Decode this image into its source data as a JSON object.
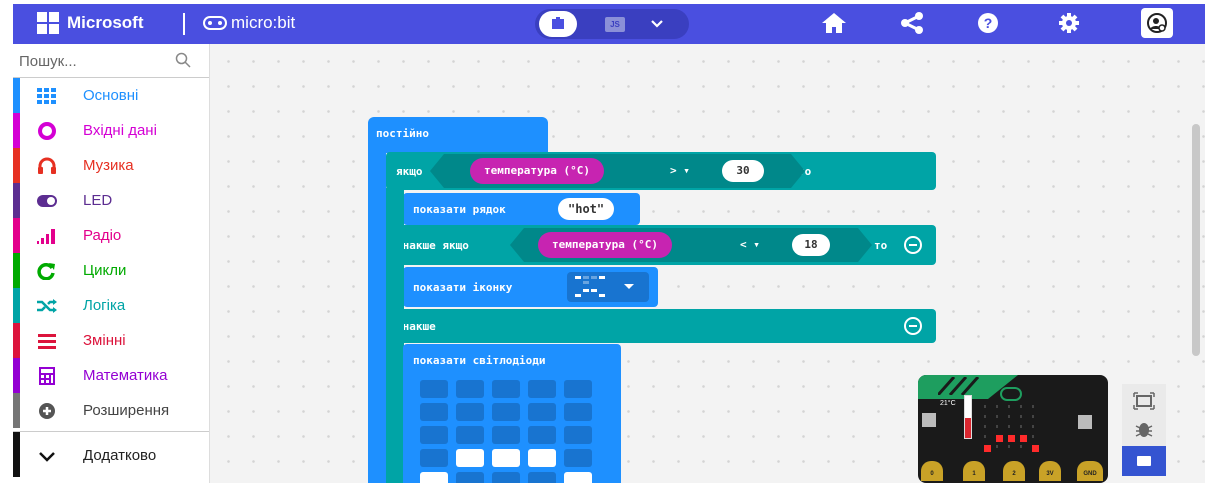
{
  "header": {
    "brand": "Microsoft",
    "product": "micro:bit",
    "editor_toggle": {
      "blocks_icon": "puzzle-icon",
      "js_label": "JS",
      "dropdown_icon": "chevron-down-icon"
    },
    "icons": [
      "home-icon",
      "share-icon",
      "help-icon",
      "settings-icon",
      "user-icon"
    ]
  },
  "toolbox": {
    "search_placeholder": "Пошук...",
    "categories": [
      {
        "label": "Основні",
        "color": "#1e90ff",
        "icon": "grid-icon"
      },
      {
        "label": "Вхідні дані",
        "color": "#d400d4",
        "icon": "circle-icon"
      },
      {
        "label": "Музика",
        "color": "#e63022",
        "icon": "headphones-icon"
      },
      {
        "label": "LED",
        "color": "#5c2d91",
        "icon": "toggle-icon"
      },
      {
        "label": "Радіо",
        "color": "#e3008c",
        "icon": "signal-icon"
      },
      {
        "label": "Цикли",
        "color": "#00aa00",
        "icon": "loop-icon"
      },
      {
        "label": "Логіка",
        "color": "#00a4a6",
        "icon": "shuffle-icon"
      },
      {
        "label": "Змінні",
        "color": "#dc143c",
        "icon": "lines-icon"
      },
      {
        "label": "Математика",
        "color": "#9400d3",
        "icon": "calculator-icon"
      },
      {
        "label": "Розширення",
        "color": "#757575",
        "icon": "plus-circle-icon"
      },
      {
        "label": "Додатково",
        "color": "#111111",
        "icon": "chevron-down-icon"
      }
    ]
  },
  "blocks": {
    "forever": "постійно",
    "if": "якщо",
    "then": "то",
    "sensor": "температура (°C)",
    "op_gt": ">",
    "num_30": "30",
    "show_string": "показати рядок",
    "string_value": "hot",
    "else_if": "інакше якщо",
    "op_lt": "<",
    "num_18": "18",
    "show_icon": "показати іконку",
    "else": "інакше",
    "show_leds": "показати світлодіоди",
    "leds": [
      [
        0,
        0,
        0,
        0,
        0
      ],
      [
        0,
        0,
        0,
        0,
        0
      ],
      [
        0,
        0,
        0,
        0,
        0
      ],
      [
        0,
        1,
        1,
        1,
        0
      ],
      [
        1,
        0,
        0,
        0,
        1
      ]
    ]
  },
  "simulator": {
    "temperature": "21°C",
    "pins": [
      "0",
      "1",
      "2",
      "3V",
      "GND"
    ]
  }
}
